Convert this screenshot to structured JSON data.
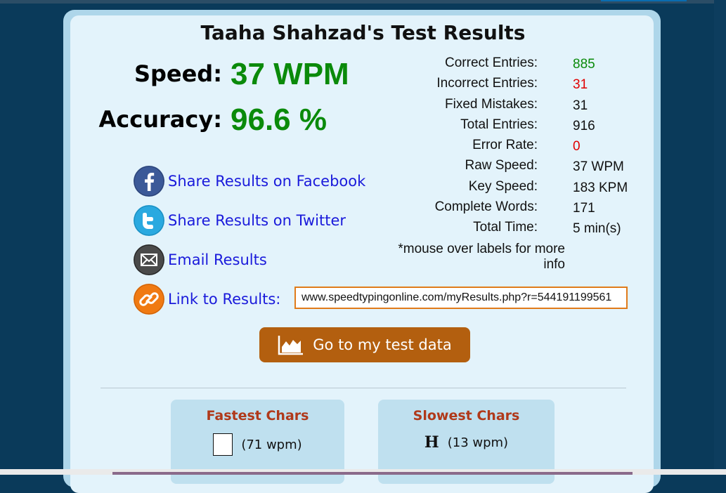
{
  "title": "Taaha Shahzad's Test Results",
  "speed": {
    "label": "Speed:",
    "value": "37 WPM"
  },
  "accuracy": {
    "label": "Accuracy:",
    "value": "96.6 %"
  },
  "stats": [
    {
      "label": "Correct Entries:",
      "value": "885",
      "color": "#0a8a0a"
    },
    {
      "label": "Incorrect Entries:",
      "value": "31",
      "color": "#e00000"
    },
    {
      "label": "Fixed Mistakes:",
      "value": "31",
      "color": "#111111"
    },
    {
      "label": "Total Entries:",
      "value": "916",
      "color": "#111111"
    },
    {
      "label": "Error Rate:",
      "value": "0",
      "color": "#e00000"
    },
    {
      "label": "Raw Speed:",
      "value": "37 WPM",
      "color": "#111111"
    },
    {
      "label": "Key Speed:",
      "value": "183 KPM",
      "color": "#111111"
    },
    {
      "label": "Complete Words:",
      "value": "171",
      "color": "#111111"
    },
    {
      "label": "Total Time:",
      "value": "5 min(s)",
      "color": "#111111"
    }
  ],
  "mouse_note": "*mouse over labels for more info",
  "share": {
    "facebook": {
      "label": "Share Results on Facebook",
      "icon": "facebook-icon"
    },
    "twitter": {
      "label": "Share Results on Twitter",
      "icon": "twitter-icon"
    },
    "email": {
      "label": "Email Results",
      "icon": "email-icon"
    },
    "link": {
      "label": "Link to Results:",
      "icon": "link-icon",
      "url": "www.speedtypingonline.com/myResults.php?r=544191199561"
    }
  },
  "go_button": {
    "label": "Go to my test data",
    "icon": "chart-area-icon"
  },
  "fastest": {
    "title": "Fastest Chars",
    "char": "",
    "value": "(71 wpm)"
  },
  "slowest": {
    "title": "Slowest Chars",
    "char": "H",
    "value": "(13 wpm)"
  },
  "colors": {
    "page_bg": "#0a3a5a",
    "panel_bg": "#e3f3fb",
    "accent_green": "#0a8a0a",
    "error_red": "#e00000",
    "link_blue": "#1a1adb",
    "button_brown": "#b35f0f",
    "char_title": "#b0391a"
  }
}
